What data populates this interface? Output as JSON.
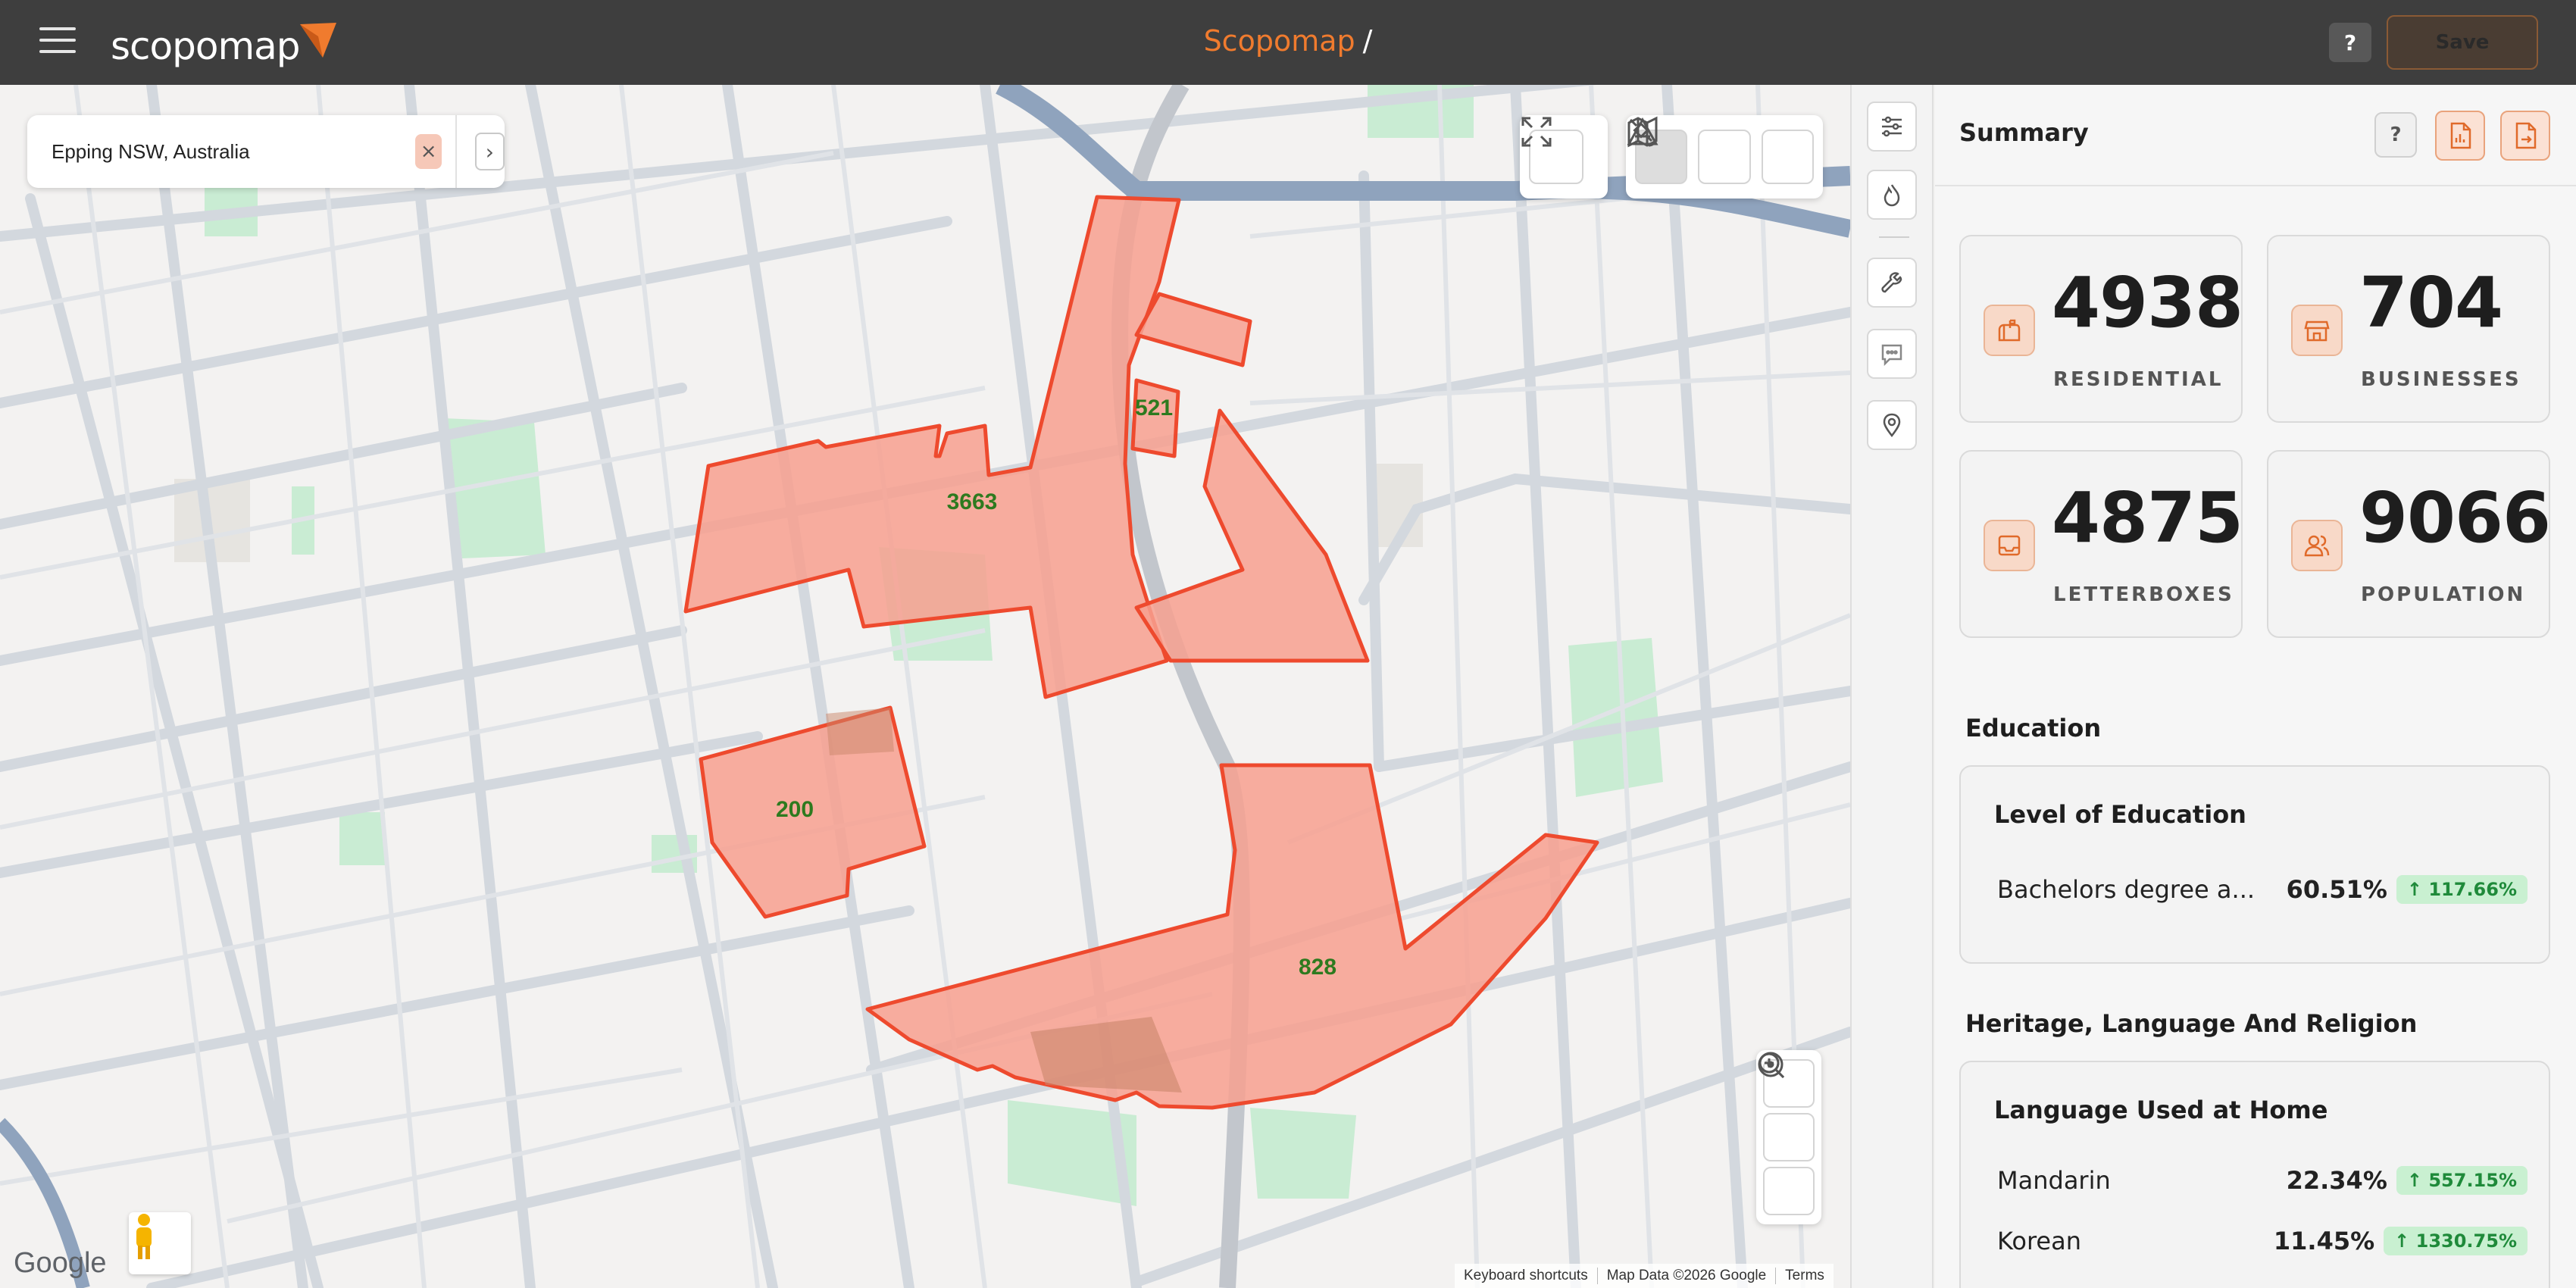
{
  "header": {
    "logo_text": "scopomap",
    "app_title": "Scopomap",
    "title_separator": "/",
    "help_label": "?",
    "save_label": "Save"
  },
  "map": {
    "search": {
      "value": "Epping NSW, Australia",
      "clear_label": "×",
      "go_label": "›"
    },
    "regions": [
      {
        "label": "3663"
      },
      {
        "label": "521"
      },
      {
        "label": "200"
      },
      {
        "label": "828"
      }
    ],
    "google_label": "Google",
    "footer": {
      "shortcuts": "Keyboard shortcuts",
      "map_data": "Map Data ©2026 Google",
      "terms": "Terms"
    },
    "icons": {
      "fullscreen": "fullscreen-icon",
      "map_type": "map-layers-icon",
      "satellite": "satellite-icon",
      "terrain": "terrain-icon",
      "locate": "locate-icon",
      "zoom_in": "zoom-in-icon",
      "zoom_out": "zoom-out-icon",
      "pegman": "street-view-icon"
    },
    "colors": {
      "region_fill": "#f7a08f",
      "region_stroke": "#ee4a2e",
      "label_color": "#2e7a1f"
    }
  },
  "tools": [
    {
      "icon": "sliders-icon"
    },
    {
      "icon": "flame-icon"
    },
    {
      "icon": "wrench-icon"
    },
    {
      "icon": "chat-icon"
    },
    {
      "icon": "map-pin-icon"
    }
  ],
  "summary": {
    "title": "Summary",
    "help_label": "?",
    "stats": [
      {
        "value": "4938",
        "label": "RESIDENTIAL",
        "icon": "mailbox-icon"
      },
      {
        "value": "704",
        "label": "BUSINESSES",
        "icon": "store-icon"
      },
      {
        "value": "4875",
        "label": "LETTERBOXES",
        "icon": "inbox-icon"
      },
      {
        "value": "9066",
        "label": "POPULATION",
        "icon": "people-icon"
      }
    ],
    "education": {
      "section_title": "Education",
      "card_title": "Level of Education",
      "rows": [
        {
          "name": "Bachelors degree a...",
          "pct": "60.51%",
          "change": "↑ 117.66%"
        }
      ]
    },
    "heritage": {
      "section_title": "Heritage, Language And Religion",
      "card_title": "Language Used at Home",
      "rows": [
        {
          "name": "Mandarin",
          "pct": "22.34%",
          "change": "↑ 557.15%"
        },
        {
          "name": "Korean",
          "pct": "11.45%",
          "change": "↑ 1330.75%"
        }
      ]
    },
    "accent_color": "#f07b2e"
  }
}
